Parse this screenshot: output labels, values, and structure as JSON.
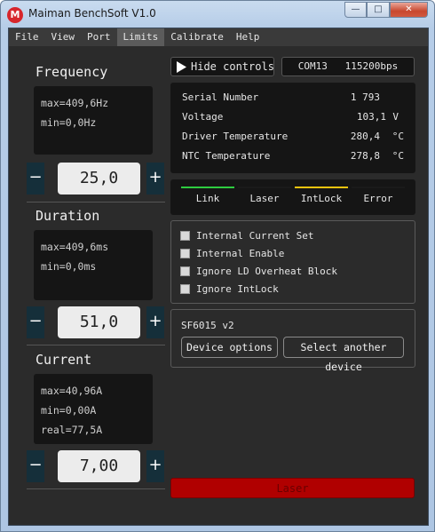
{
  "window": {
    "title": "Maiman BenchSoft V1.0",
    "logo_letter": "M",
    "min": "—",
    "max": "□",
    "close": "✕"
  },
  "menu": [
    "File",
    "View",
    "Port",
    "Limits",
    "Calibrate",
    "Help"
  ],
  "active_menu": "Limits",
  "frequency": {
    "title": "Frequency",
    "max": "max=409,6Hz",
    "min": "min=0,0Hz",
    "value": "25,0"
  },
  "duration": {
    "title": "Duration",
    "max": "max=409,6ms",
    "min": "min=0,0ms",
    "value": "51,0"
  },
  "current": {
    "title": "Current",
    "max": "max=40,96A",
    "min": "min=0,00A",
    "real": "real=77,5A",
    "value": "7,00"
  },
  "stepper": {
    "minus": "−",
    "plus": "+"
  },
  "hide_controls": {
    "label": "Hide controls",
    "icon": "play-triangle-icon"
  },
  "port_info": "COM13   115200bps",
  "status": [
    {
      "label": "Serial Number",
      "value": "1 793",
      "unit": ""
    },
    {
      "label": "Voltage",
      "value": "103,1",
      "unit": "V"
    },
    {
      "label": "Driver Temperature",
      "value": "280,4",
      "unit": "°C"
    },
    {
      "label": "NTC Temperature",
      "value": "278,8",
      "unit": "°C"
    }
  ],
  "indicators": [
    {
      "label": "Link",
      "color": "#2ecc40"
    },
    {
      "label": "Laser",
      "color": "#1a1a1a"
    },
    {
      "label": "IntLock",
      "color": "#f2c40f"
    },
    {
      "label": "Error",
      "color": "#1a1a1a"
    }
  ],
  "checkboxes": [
    "Internal Current Set",
    "Internal Enable",
    "Ignore LD Overheat Block",
    "Ignore IntLock"
  ],
  "device": {
    "name": "SF6015 v2",
    "options_label": "Device options",
    "select_label": "Select another device"
  },
  "laser_button": "Laser",
  "colors": {
    "laser_button": "#b00000",
    "background": "#2b2b2b"
  }
}
